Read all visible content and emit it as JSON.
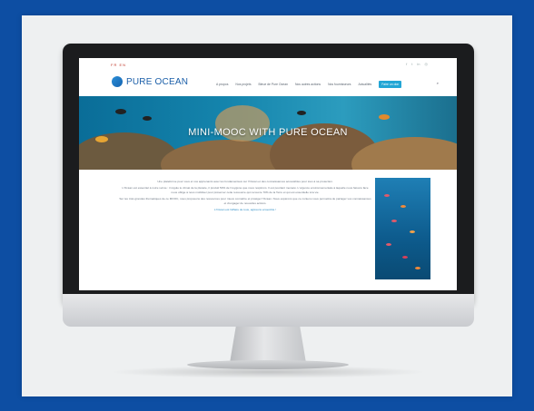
{
  "site": {
    "lang_flags": "FR EN",
    "social_icons": [
      "facebook-icon",
      "twitter-icon",
      "linkedin-icon",
      "instagram-icon"
    ],
    "brand": "PURE OCEAN",
    "nav": [
      "A propos",
      "Nos projets",
      "Bleue de Pure Ocean",
      "Nos autres actions",
      "Nos fournisseurs",
      "Actualités"
    ],
    "cta": "Faire un don",
    "hero_title": "MINI-MOOC WITH PURE OCEAN",
    "paragraphs": [
      "Une plateforme pour vous et vos apprenants avec les fondamentaux sur l'Océan et des connaissances accessibles pour tous à sa protection.",
      "L'Océan est essentiel à notre survie : il régule le climat de la planète, il produit 50% de l'oxygène que nous respirons. Il est pourtant menacé. L'urgence environnementale à laquelle nous faisons face nous oblige à nous mobiliser pour préserver cette ressource qui recouvre 70% de la Terre et qui est essentielle à la vie.",
      "Sur les trois grandes thématiques de ce MOOC, nous proposons des ressources pour mieux connaître et protéger l'Océan. Nous espérons que ce contenu vous permettra de partager vos connaissances et d'engager de nouvelles actions.",
      "L'Océan est l'affaire de tous, agissons ensemble !"
    ],
    "colors": {
      "brand_blue": "#1a5ea8",
      "cta": "#23a6d5",
      "page_bg": "#0d4ea3"
    }
  }
}
